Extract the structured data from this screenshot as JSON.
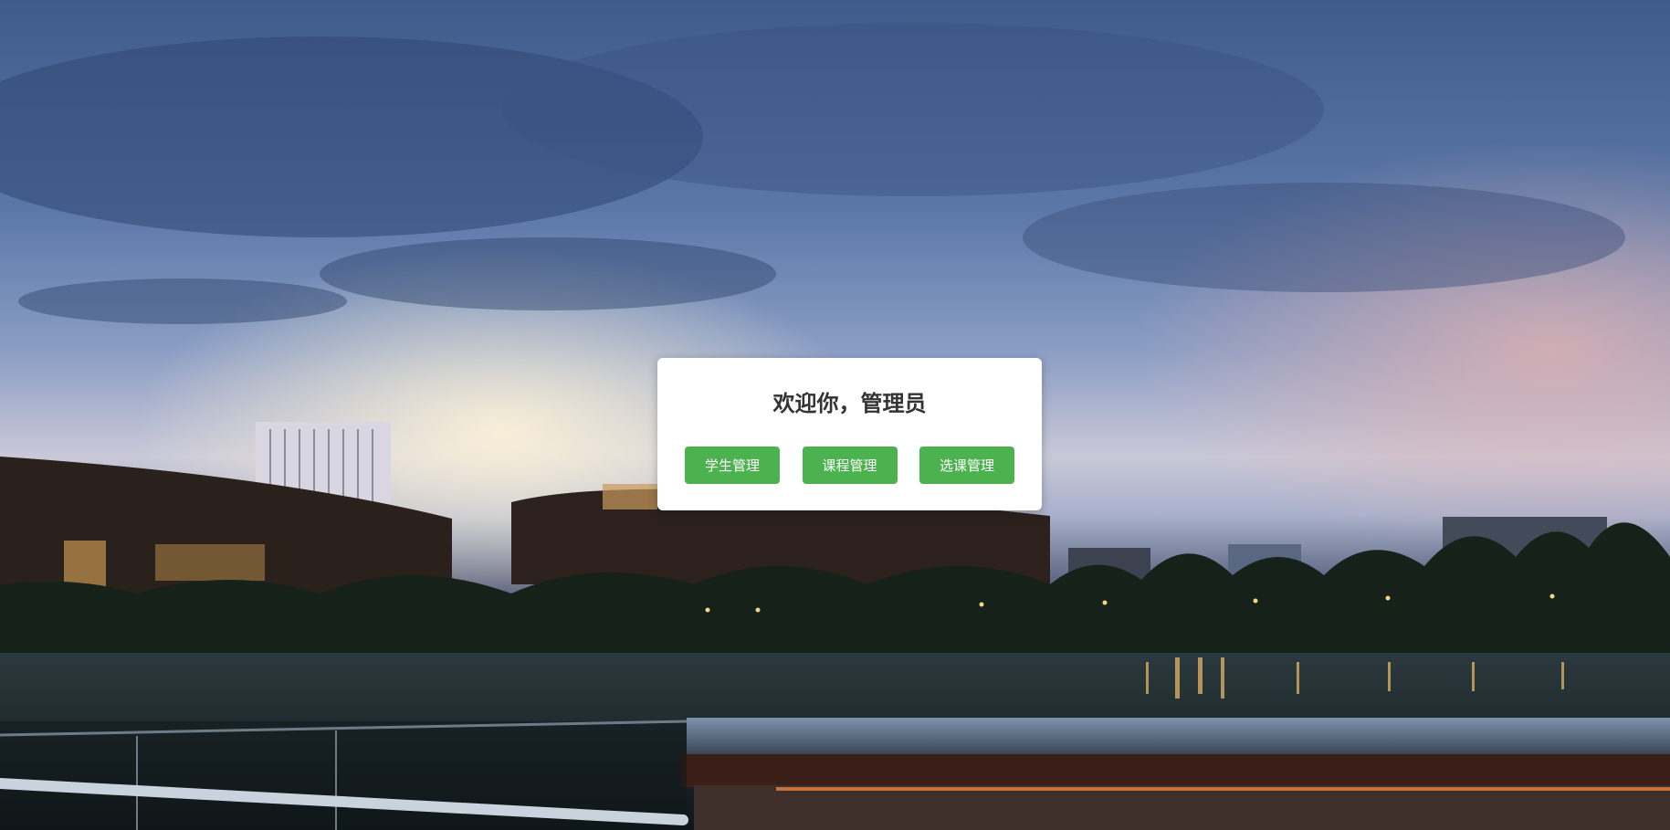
{
  "welcome": {
    "title": "欢迎你，管理员"
  },
  "buttons": [
    {
      "label": "学生管理"
    },
    {
      "label": "课程管理"
    },
    {
      "label": "选课管理"
    }
  ],
  "colors": {
    "button_bg": "#4cb24f",
    "button_text": "#ffffff",
    "card_bg": "#ffffff",
    "title_text": "#333333"
  }
}
